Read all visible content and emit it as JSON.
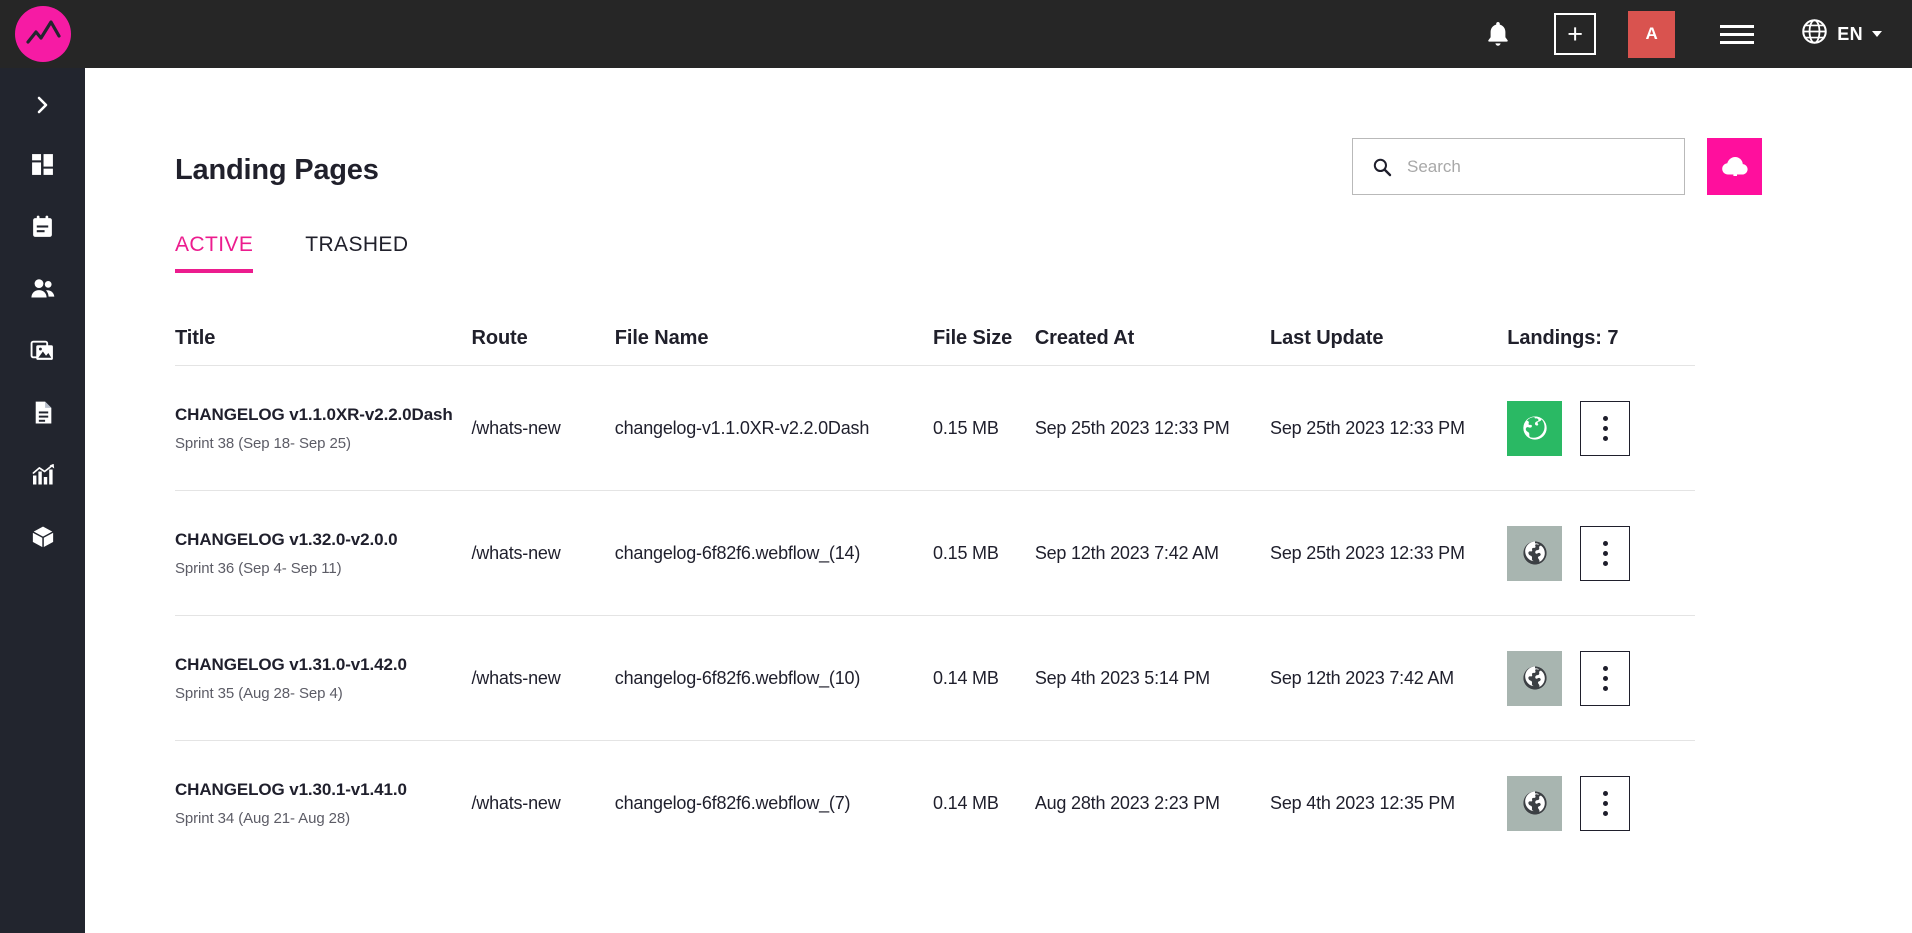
{
  "topbar": {
    "logo_icon": "mountain-chart-logo",
    "bell_icon": "notification-bell-icon",
    "add_label": "+",
    "avatar_initial": "A",
    "menu_icon": "hamburger-menu-icon",
    "globe_icon": "globe-icon",
    "language": "EN",
    "brand_pink": "#f61ba4",
    "avatar_red": "#d9534f",
    "bar_bg": "#262626"
  },
  "sidebar": {
    "bg": "#22252e",
    "items": [
      {
        "icon": "chevron-right-expand-icon",
        "name": "expand-sidebar"
      },
      {
        "icon": "dashboard-grid-icon",
        "name": "dashboard"
      },
      {
        "icon": "calendar-icon",
        "name": "calendar"
      },
      {
        "icon": "users-icon",
        "name": "users"
      },
      {
        "icon": "image-gallery-icon",
        "name": "media"
      },
      {
        "icon": "document-icon",
        "name": "documents"
      },
      {
        "icon": "bar-chart-icon",
        "name": "analytics"
      },
      {
        "icon": "cube-box-icon",
        "name": "packages"
      }
    ]
  },
  "page": {
    "title": "Landing Pages"
  },
  "search": {
    "icon": "search-icon",
    "placeholder": "Search",
    "value": ""
  },
  "upload": {
    "icon": "cloud-upload-icon",
    "color": "#ff0f9d"
  },
  "tabs": [
    {
      "label": "ACTIVE",
      "active": true
    },
    {
      "label": "TRASHED",
      "active": false
    }
  ],
  "table": {
    "headers": {
      "title": "Title",
      "route": "Route",
      "file_name": "File Name",
      "file_size": "File Size",
      "created_at": "Created At",
      "last_update": "Last Update",
      "actions": "Landings: 7"
    },
    "rows": [
      {
        "title": "CHANGELOG v1.1.0XR-v2.2.0Dash",
        "subtitle": "Sprint 38 (Sep 18- Sep 25)",
        "route": "/whats-new",
        "file_name": "changelog-v1.1.0XR-v2.2.0Dash",
        "file_size": "0.15 MB",
        "created_at": "Sep 25th 2023 12:33 PM",
        "last_update": "Sep 25th 2023 12:33 PM",
        "status": "published",
        "status_color": "#2ab964"
      },
      {
        "title": "CHANGELOG v1.32.0-v2.0.0",
        "subtitle": "Sprint 36 (Sep 4- Sep 11)",
        "route": "/whats-new",
        "file_name": "changelog-6f82f6.webflow_(14)",
        "file_size": "0.15 MB",
        "created_at": "Sep 12th 2023 7:42 AM",
        "last_update": "Sep 25th 2023 12:33 PM",
        "status": "unpublished",
        "status_color": "#a8b5b0"
      },
      {
        "title": "CHANGELOG v1.31.0-v1.42.0",
        "subtitle": "Sprint 35 (Aug 28- Sep 4)",
        "route": "/whats-new",
        "file_name": "changelog-6f82f6.webflow_(10)",
        "file_size": "0.14 MB",
        "created_at": "Sep 4th 2023 5:14 PM",
        "last_update": "Sep 12th 2023 7:42 AM",
        "status": "unpublished",
        "status_color": "#a8b5b0"
      },
      {
        "title": "CHANGELOG v1.30.1-v1.41.0",
        "subtitle": "Sprint 34 (Aug 21- Aug 28)",
        "route": "/whats-new",
        "file_name": "changelog-6f82f6.webflow_(7)",
        "file_size": "0.14 MB",
        "created_at": "Aug 28th 2023 2:23 PM",
        "last_update": "Sep 4th 2023 12:35 PM",
        "status": "unpublished",
        "status_color": "#a8b5b0"
      }
    ],
    "row_action_icons": {
      "globe": "globe-status-icon",
      "menu": "kebab-menu-icon"
    }
  }
}
